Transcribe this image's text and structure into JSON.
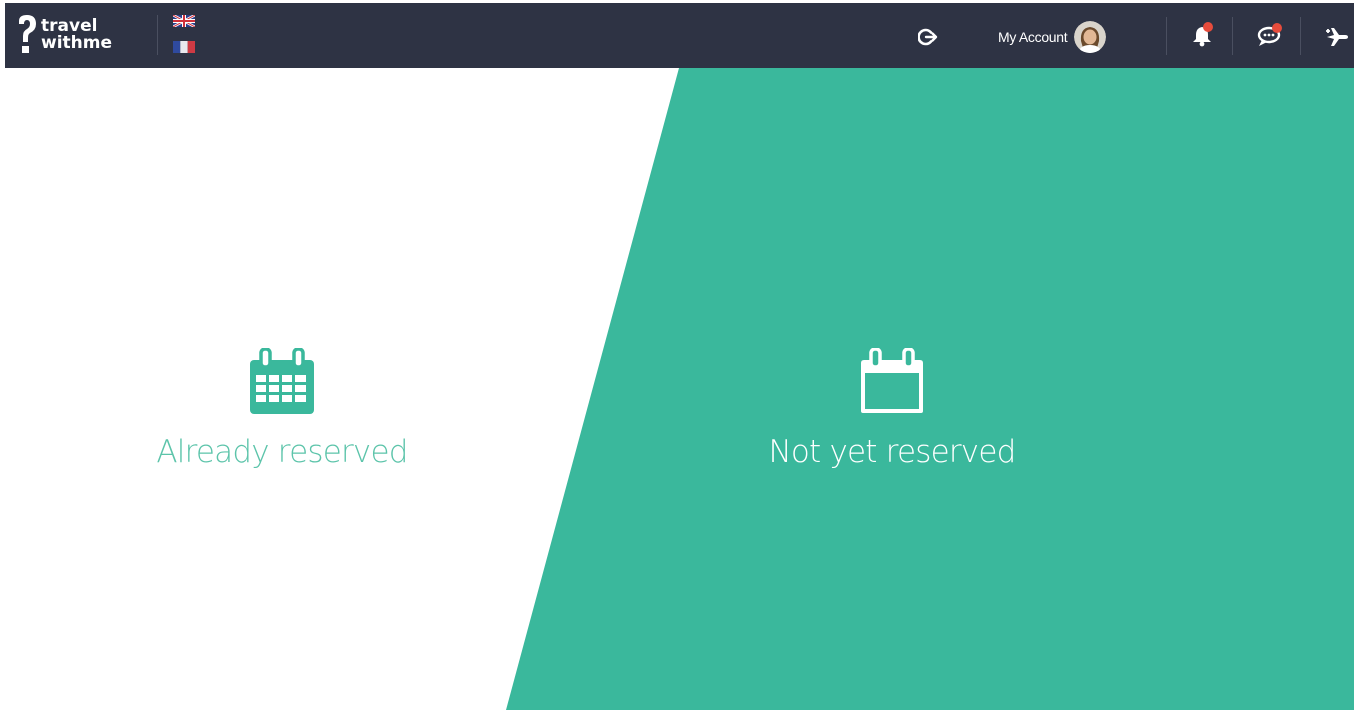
{
  "brand": {
    "line1": "travel",
    "line2": "withme",
    "accent": "#3ab89c",
    "navbar": "#2e3344"
  },
  "header": {
    "languages": [
      {
        "code": "en",
        "icon": "uk-flag-icon"
      },
      {
        "code": "fr",
        "icon": "france-flag-icon"
      }
    ],
    "logout_icon": "sign-out-icon",
    "account_label": "My Account",
    "notifications": {
      "icon": "bell-icon",
      "badge_color": "#e74c3c"
    },
    "messages": {
      "icon": "chat-bubble-icon",
      "badge_color": "#e74c3c"
    },
    "trips": {
      "icon": "plane-add-icon"
    }
  },
  "main": {
    "options": [
      {
        "label": "Already reserved",
        "icon": "calendar-grid-icon",
        "color": "#5cc4aa"
      },
      {
        "label": "Not yet reserved",
        "icon": "calendar-empty-icon",
        "color": "#ffffff"
      }
    ]
  }
}
